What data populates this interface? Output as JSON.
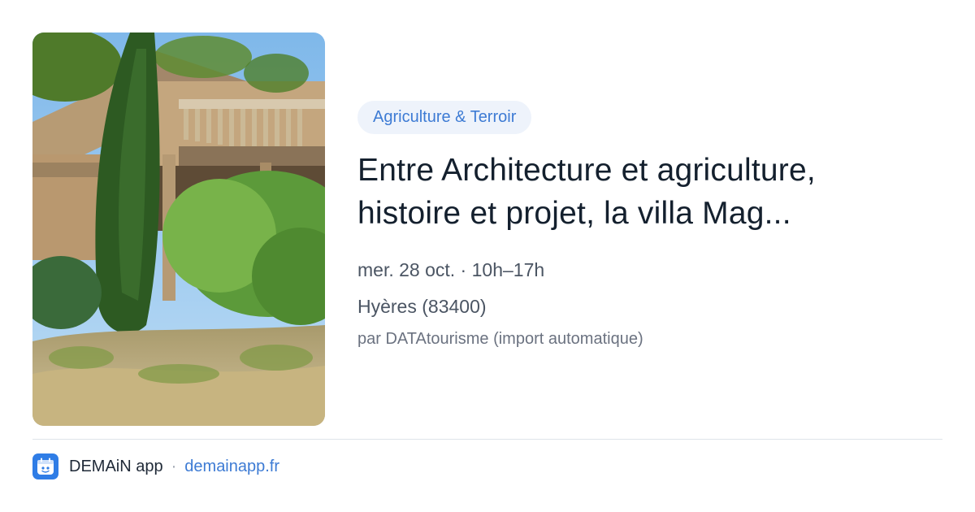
{
  "event": {
    "tag": "Agriculture & Terroir",
    "title": "Entre Architecture et agriculture, histoire et projet, la villa Mag...",
    "date_time": "mer. 28 oct. · 10h–17h",
    "location": "Hyères (83400)",
    "source": "par DATAtourisme (import automatique)",
    "image_icon": "villa-photo"
  },
  "footer": {
    "app_name": "DEMAiN app",
    "separator": "·",
    "domain": "demainapp.fr",
    "logo_icon": "app-logo-icon"
  },
  "colors": {
    "accent": "#3d7bd4",
    "tag_background": "#eef3fb",
    "title": "#14202e",
    "logo": "#2f7de6"
  }
}
